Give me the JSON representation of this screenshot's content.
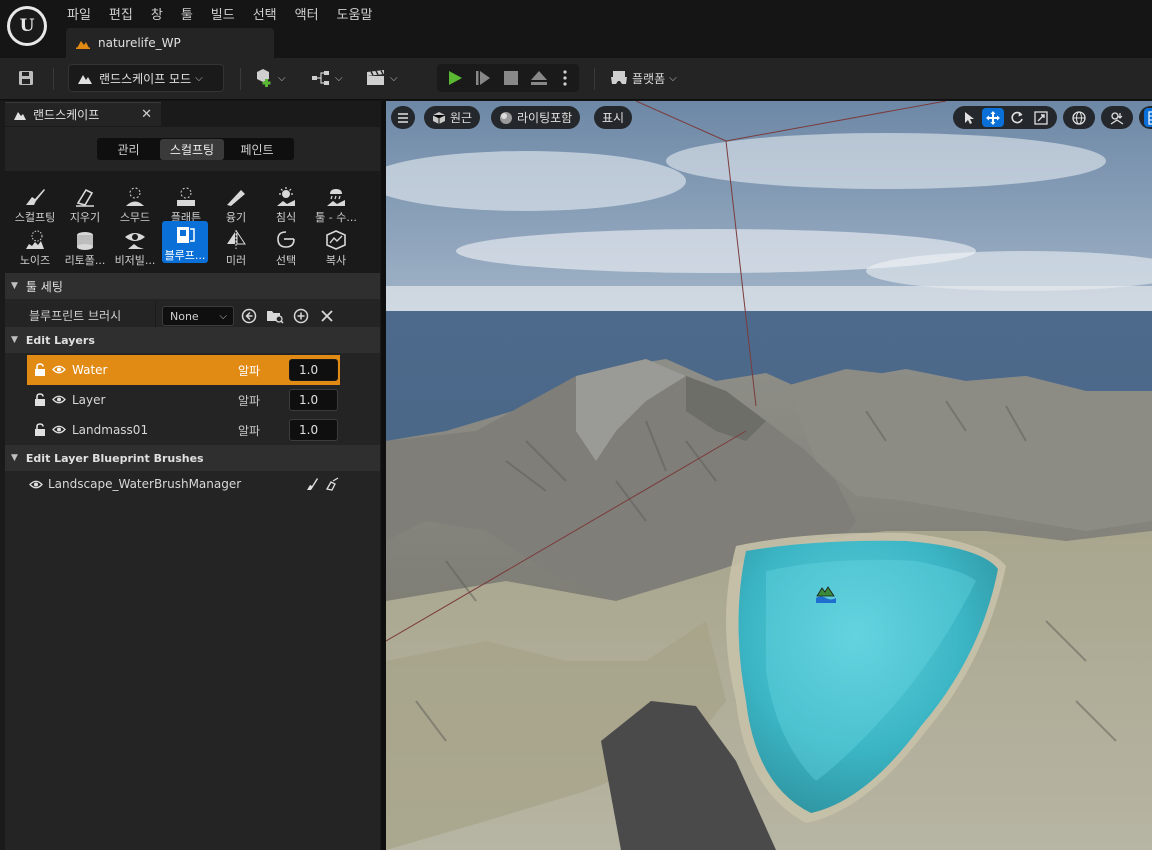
{
  "menu": {
    "items": [
      "파일",
      "편집",
      "창",
      "툴",
      "빌드",
      "선택",
      "액터",
      "도움말"
    ]
  },
  "document_tab": {
    "label": "naturelife_WP"
  },
  "toolbar": {
    "mode_label": "랜드스케이프 모드",
    "platform_label": "플랫폼"
  },
  "panel": {
    "tab_title": "랜드스케이프",
    "mode_tabs": [
      "관리",
      "스컬프팅",
      "페인트"
    ],
    "active_mode": "스컬프팅",
    "tools_row1": [
      {
        "label": "스컬프팅",
        "icon": "sculpt-icon"
      },
      {
        "label": "지우기",
        "icon": "erase-icon"
      },
      {
        "label": "스무드",
        "icon": "smooth-icon"
      },
      {
        "label": "플래튼",
        "icon": "flatten-icon"
      },
      {
        "label": "융기",
        "icon": "ramp-icon"
      },
      {
        "label": "침식",
        "icon": "erosion-icon"
      },
      {
        "label": "툴 - 수...",
        "icon": "hydro-erosion-icon"
      }
    ],
    "tools_row2": [
      {
        "label": "노이즈",
        "icon": "noise-icon"
      },
      {
        "label": "리토폴...",
        "icon": "retopologize-icon"
      },
      {
        "label": "비저빌...",
        "icon": "visibility-icon"
      },
      {
        "label": "블루프...",
        "icon": "blueprint-icon"
      },
      {
        "label": "미러",
        "icon": "mirror-icon"
      },
      {
        "label": "선택",
        "icon": "select-icon"
      },
      {
        "label": "복사",
        "icon": "copy-icon"
      }
    ],
    "active_tool": "블루프...",
    "tool_settings": {
      "header": "툴 세팅",
      "blueprint_brush_label": "블루프린트 브러시",
      "blueprint_brush_value": "None"
    },
    "edit_layers": {
      "header": "Edit Layers",
      "alpha_label": "알파",
      "layers": [
        {
          "name": "Water",
          "alpha": "1.0",
          "selected": true
        },
        {
          "name": "Layer",
          "alpha": "1.0",
          "selected": false
        },
        {
          "name": "Landmass01",
          "alpha": "1.0",
          "selected": false
        }
      ]
    },
    "bp_brushes": {
      "header": "Edit Layer Blueprint Brushes",
      "items": [
        "Landscape_WaterBrushManager"
      ]
    }
  },
  "viewport": {
    "perspective_label": "원근",
    "lighting_label": "라이팅포함",
    "show_label": "표시"
  },
  "colors": {
    "accent": "#0a70d8",
    "selected_layer": "#e18a14",
    "play": "#5bb833"
  }
}
